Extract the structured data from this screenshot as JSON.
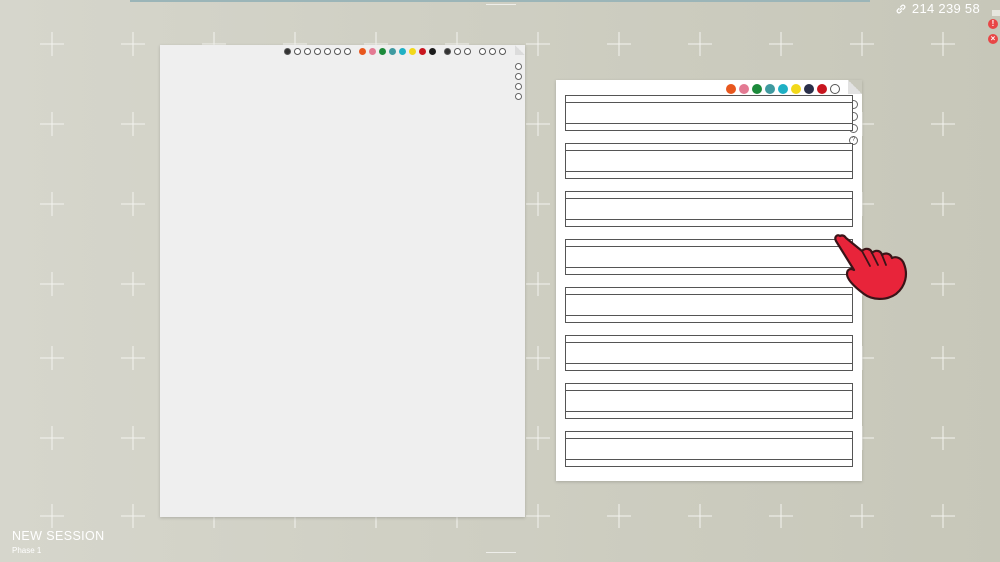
{
  "session": {
    "code": "214 239 58",
    "title": "NEW SESSION",
    "phase": "Phase 1"
  },
  "controls": {
    "alert_label": "!",
    "close_label": "×"
  },
  "left_paper": {
    "tools": [
      "pen-tool",
      "wave-tool",
      "wave-tool-2",
      "wave-tool-3",
      "check-tool",
      "check-tool-2",
      "dot-tool"
    ],
    "colors": [
      "#e8571e",
      "#e37a93",
      "#1c8a3b",
      "#3f9aa0",
      "#1fb0c4",
      "#f2d81a",
      "#c8161f",
      "#1c1c1c"
    ],
    "extra_tools": [
      "edit-tool",
      "check-tool-3",
      "undo-tool"
    ],
    "history_tools": [
      "rotate-tool",
      "rotate-tool-2",
      "more-tool"
    ],
    "side_tools": [
      "page-tool",
      "draw-tool",
      "target-tool",
      "info-tool"
    ]
  },
  "right_paper": {
    "colors": [
      "#e8571e",
      "#e37a93",
      "#1c8a3b",
      "#3f9aa0",
      "#1fb0c4",
      "#f2d81a",
      "#2a2f4a",
      "#c8161f",
      "#ffffff"
    ],
    "side_tools": [
      "page-tool",
      "draw-tool",
      "link-tool"
    ],
    "help_label": "?",
    "staff_count": 8
  },
  "theme": {
    "accent": "#e84646",
    "hand_color": "#e8243a"
  }
}
